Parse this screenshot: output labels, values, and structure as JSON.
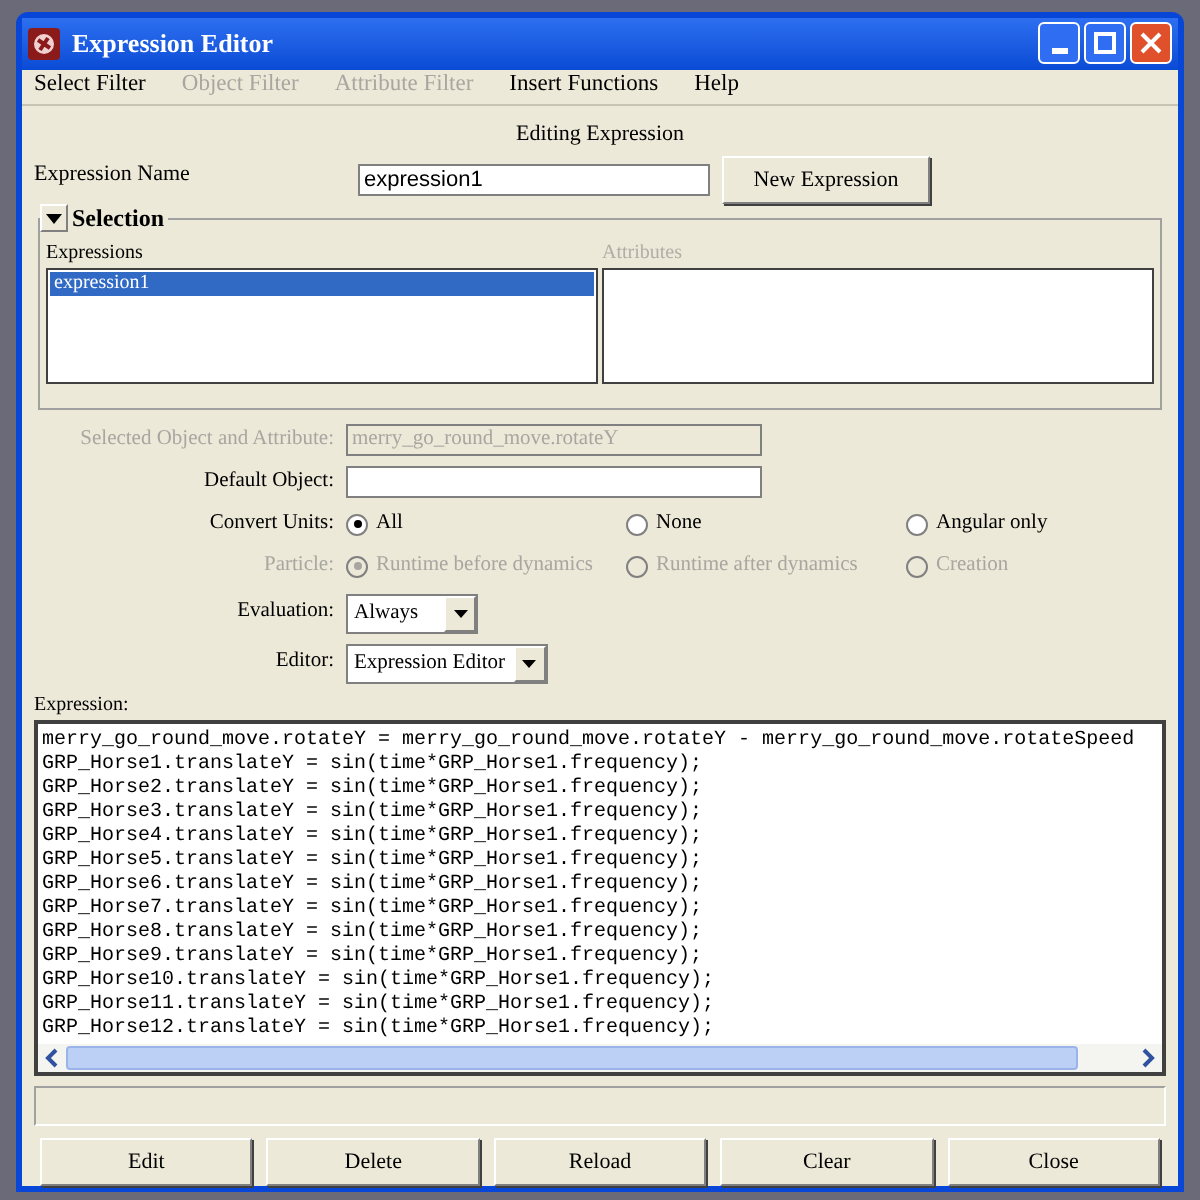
{
  "window": {
    "title": "Expression Editor"
  },
  "menu": [
    {
      "label": "Select Filter",
      "disabled": false
    },
    {
      "label": "Object Filter",
      "disabled": true
    },
    {
      "label": "Attribute Filter",
      "disabled": true
    },
    {
      "label": "Insert Functions",
      "disabled": false
    },
    {
      "label": "Help",
      "disabled": false
    }
  ],
  "heading": "Editing Expression",
  "expression_name": {
    "label": "Expression Name",
    "value": "expression1"
  },
  "new_expression_button": "New Expression",
  "selection": {
    "title": "Selection",
    "expanded": true,
    "expressions": {
      "label": "Expressions",
      "items": [
        {
          "label": "expression1",
          "selected": true
        }
      ]
    },
    "attributes": {
      "label": "Attributes",
      "disabled": true
    }
  },
  "fields": [
    {
      "kind": "text",
      "label": "Selected Object and Attribute:",
      "value": "merry_go_round_move.rotateY",
      "disabled": true
    },
    {
      "kind": "text",
      "label": "Default Object:",
      "disabled": false
    },
    {
      "kind": "radio",
      "label": "Convert Units:",
      "disabled": false,
      "options": [
        {
          "label": "All",
          "selected": true
        },
        {
          "label": "None",
          "selected": false
        },
        {
          "label": "Angular only",
          "selected": false
        }
      ]
    },
    {
      "kind": "radio",
      "label": "Particle:",
      "disabled": true,
      "options": [
        {
          "label": "Runtime before dynamics",
          "selected": true
        },
        {
          "label": "Runtime after dynamics",
          "selected": false
        },
        {
          "label": "Creation",
          "selected": false
        }
      ]
    },
    {
      "kind": "dropdown",
      "label": "Evaluation:",
      "value": "Always",
      "disabled": false
    },
    {
      "kind": "dropdown",
      "label": "Editor:",
      "value": "Expression Editor",
      "disabled": false
    }
  ],
  "expression": {
    "label": "Expression:",
    "lines": [
      "merry_go_round_move.rotateY = merry_go_round_move.rotateY - merry_go_round_move.rotateSpeed",
      "GRP_Horse1.translateY = sin(time*GRP_Horse1.frequency);",
      "GRP_Horse2.translateY = sin(time*GRP_Horse1.frequency);",
      "GRP_Horse3.translateY = sin(time*GRP_Horse1.frequency);",
      "GRP_Horse4.translateY = sin(time*GRP_Horse1.frequency);",
      "GRP_Horse5.translateY = sin(time*GRP_Horse1.frequency);",
      "GRP_Horse6.translateY = sin(time*GRP_Horse1.frequency);",
      "GRP_Horse7.translateY = sin(time*GRP_Horse1.frequency);",
      "GRP_Horse8.translateY = sin(time*GRP_Horse1.frequency);",
      "GRP_Horse9.translateY = sin(time*GRP_Horse1.frequency);",
      "GRP_Horse10.translateY = sin(time*GRP_Horse1.frequency);",
      "GRP_Horse11.translateY = sin(time*GRP_Horse1.frequency);",
      "GRP_Horse12.translateY = sin(time*GRP_Horse1.frequency);"
    ]
  },
  "buttons": [
    "Edit",
    "Delete",
    "Reload",
    "Clear",
    "Close"
  ]
}
